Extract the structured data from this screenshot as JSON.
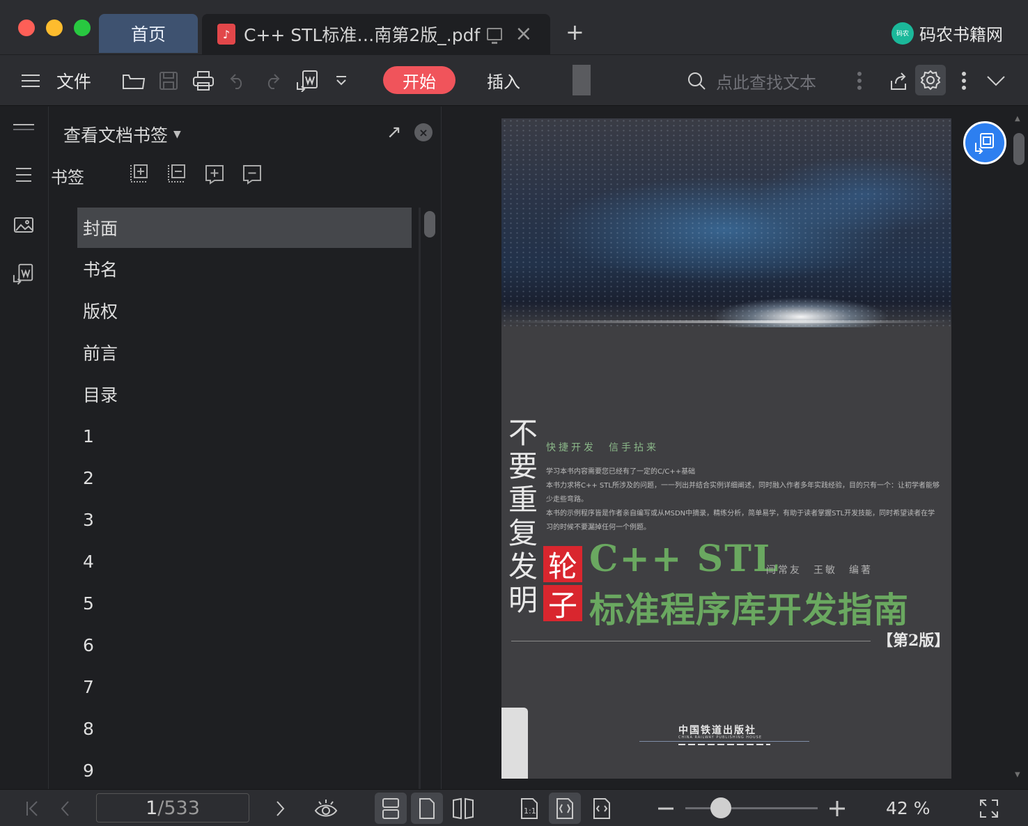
{
  "window": {
    "tabs": [
      {
        "label": "首页",
        "active": false
      },
      {
        "label": "C++ STL标准…南第2版_.pdf",
        "active": true
      }
    ],
    "new_tab": "+",
    "brand": {
      "logo_text": "码农",
      "name": "码农书籍网"
    }
  },
  "toolbar": {
    "menu_label": "文件",
    "start_label": "开始",
    "insert_label": "插入",
    "search_placeholder": "点此查找文本",
    "accent_color": "#f0545b"
  },
  "sidebar": {
    "header": "查看文档书签",
    "bookmarks_label": "书签",
    "items": [
      "封面",
      "书名",
      "版权",
      "前言",
      "目录",
      "1",
      "2",
      "3",
      "4",
      "5",
      "6",
      "7",
      "8",
      "9"
    ],
    "selected_index": 0
  },
  "document": {
    "cover": {
      "vertical_title": "不要重复发明",
      "red_chars": [
        "轮",
        "子"
      ],
      "tagline": "快捷开发　信手拈来",
      "description": [
        "学习本书内容需要您已经有了一定的C/C++基础",
        "本书力求将C++ STL所涉及的问题，一一列出并结合实例详细阐述，同时融入作者多年实践经验，目的只有一个：让初学者能够少走些弯路。",
        "本书的示例程序皆是作者亲自编写或从MSDN中摘录，精练分析，简单易学，有助于读者掌握STL开发技能，同时希望读者在学习的时候不要漏掉任何一个例题。"
      ],
      "title_line1": "C++ STL",
      "authors": "闫常友　王敏　编著",
      "title_line2": "标准程序库开发指南",
      "edition": "【第2版】",
      "publisher": "中国铁道出版社",
      "publisher_en": "CHINA RAILWAY PUBLISHING HOUSE"
    }
  },
  "statusbar": {
    "current_page": "1",
    "total_pages": "/533",
    "zoom_text": "42 %",
    "zoom_level": 0.42
  }
}
